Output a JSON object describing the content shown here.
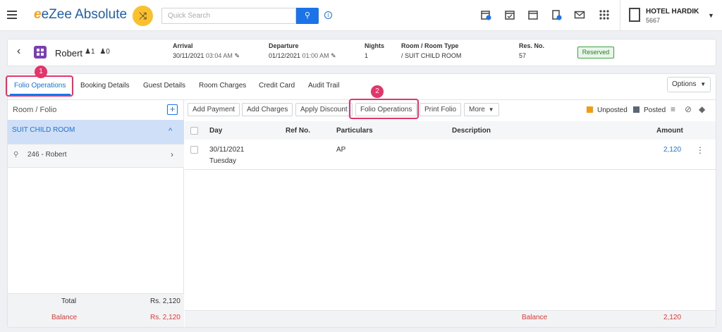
{
  "app": {
    "logo_text": "eZee Absolute",
    "search_placeholder": "Quick Search"
  },
  "hotel": {
    "name": "HOTEL HARDIK",
    "code": "5667"
  },
  "guest": {
    "name": "Robert",
    "adults": "1",
    "children": "0",
    "arrival_label": "Arrival",
    "arrival_date": "30/11/2021",
    "arrival_time": "03:04 AM",
    "departure_label": "Departure",
    "departure_date": "01/12/2021",
    "departure_time": "01:00 AM",
    "nights_label": "Nights",
    "nights": "1",
    "room_label": "Room / Room Type",
    "room": "/ SUIT CHILD ROOM",
    "resno_label": "Res. No.",
    "resno": "57",
    "status": "Reserved"
  },
  "tabs": [
    "Folio Operations",
    "Booking Details",
    "Guest Details",
    "Room Charges",
    "Credit Card",
    "Audit Trail"
  ],
  "options_label": "Options",
  "callouts": [
    "1",
    "2"
  ],
  "folio": {
    "header": "Room / Folio",
    "room": "SUIT CHILD ROOM",
    "guest_entry": "246 - Robert",
    "total_label": "Total",
    "total_value": "Rs. 2,120",
    "balance_label": "Balance",
    "balance_value": "Rs. 2,120"
  },
  "toolbar": [
    "Add Payment",
    "Add Charges",
    "Apply Discount",
    "Folio Operations",
    "Print Folio",
    "More"
  ],
  "legend": {
    "unposted": "Unposted",
    "posted": "Posted",
    "unposted_color": "#f39c12",
    "posted_color": "#5b6775"
  },
  "table": {
    "headers": {
      "day": "Day",
      "ref": "Ref No.",
      "particulars": "Particulars",
      "description": "Description",
      "amount": "Amount"
    },
    "rows": [
      {
        "date": "30/11/2021",
        "weekday": "Tuesday",
        "ref": "",
        "particulars": "AP",
        "description": "",
        "amount": "2,120"
      }
    ],
    "balance_label": "Balance",
    "balance_value": "2,120"
  },
  "colors": {
    "accent": "#1a73e8",
    "highlight": "#e4346b",
    "reserved": "#43a047"
  }
}
